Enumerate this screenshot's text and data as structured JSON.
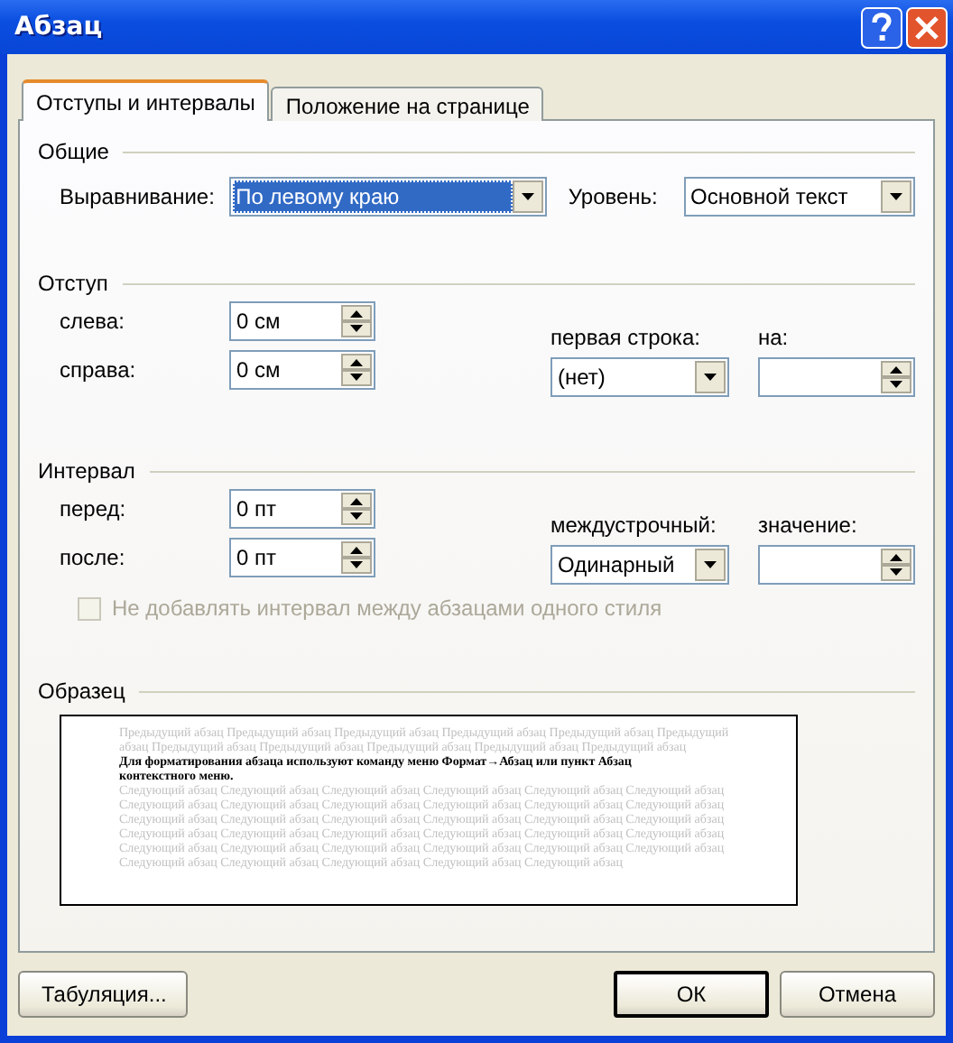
{
  "window": {
    "title": "Абзац"
  },
  "tabs": [
    {
      "label": "Отступы и интервалы",
      "selected": true
    },
    {
      "label": "Положение на странице",
      "selected": false
    }
  ],
  "general": {
    "title": "Общие",
    "alignment": {
      "label": "Выравнивание:",
      "value": "По левому краю",
      "highlighted": true
    },
    "level": {
      "label": "Уровень:",
      "value": "Основной текст",
      "highlighted": false
    }
  },
  "indent": {
    "title": "Отступ",
    "left": {
      "label": "слева:",
      "value": "0 см"
    },
    "right": {
      "label": "справа:",
      "value": "0 см"
    },
    "first_line": {
      "label": "первая строка:",
      "value": "(нет)",
      "highlighted": false
    },
    "by": {
      "label": "на:"
    }
  },
  "spacing": {
    "title": "Интервал",
    "before": {
      "label": "перед:",
      "value": "0 пт"
    },
    "after": {
      "label": "после:",
      "value": "0 пт"
    },
    "line_spacing": {
      "label": "междустрочный:",
      "value": "Одинарный",
      "highlighted": false
    },
    "at": {
      "label": "значение:"
    },
    "no_space_same_style": {
      "label": "Не добавлять интервал между абзацами одного стиля",
      "checked": false,
      "disabled": true
    }
  },
  "preview": {
    "title": "Образец",
    "previous": "Предыдущий абзац Предыдущий абзац Предыдущий абзац Предыдущий абзац Предыдущий абзац Предыдущий абзац Предыдущий абзац Предыдущий абзац Предыдущий абзац Предыдущий абзац Предыдущий абзац",
    "current": "Для форматирования абзаца используют команду меню Формат→Абзац или пункт Абзац контекстного меню.",
    "next": "Следующий абзац Следующий абзац Следующий абзац Следующий абзац Следующий абзац Следующий абзац Следующий абзац Следующий абзац Следующий абзац Следующий абзац Следующий абзац Следующий абзац Следующий абзац Следующий абзац Следующий абзац Следующий абзац Следующий абзац Следующий абзац Следующий абзац Следующий абзац Следующий абзац Следующий абзац Следующий абзац Следующий абзац Следующий абзац Следующий абзац Следующий абзац Следующий абзац Следующий абзац Следующий абзац Следующий абзац Следующий абзац Следующий абзац Следующий абзац Следующий абзац"
  },
  "buttons": [
    {
      "label": "Табуляция...",
      "default": false
    },
    {
      "label": "ОК",
      "default": true
    },
    {
      "label": "Отмена",
      "default": false
    }
  ]
}
